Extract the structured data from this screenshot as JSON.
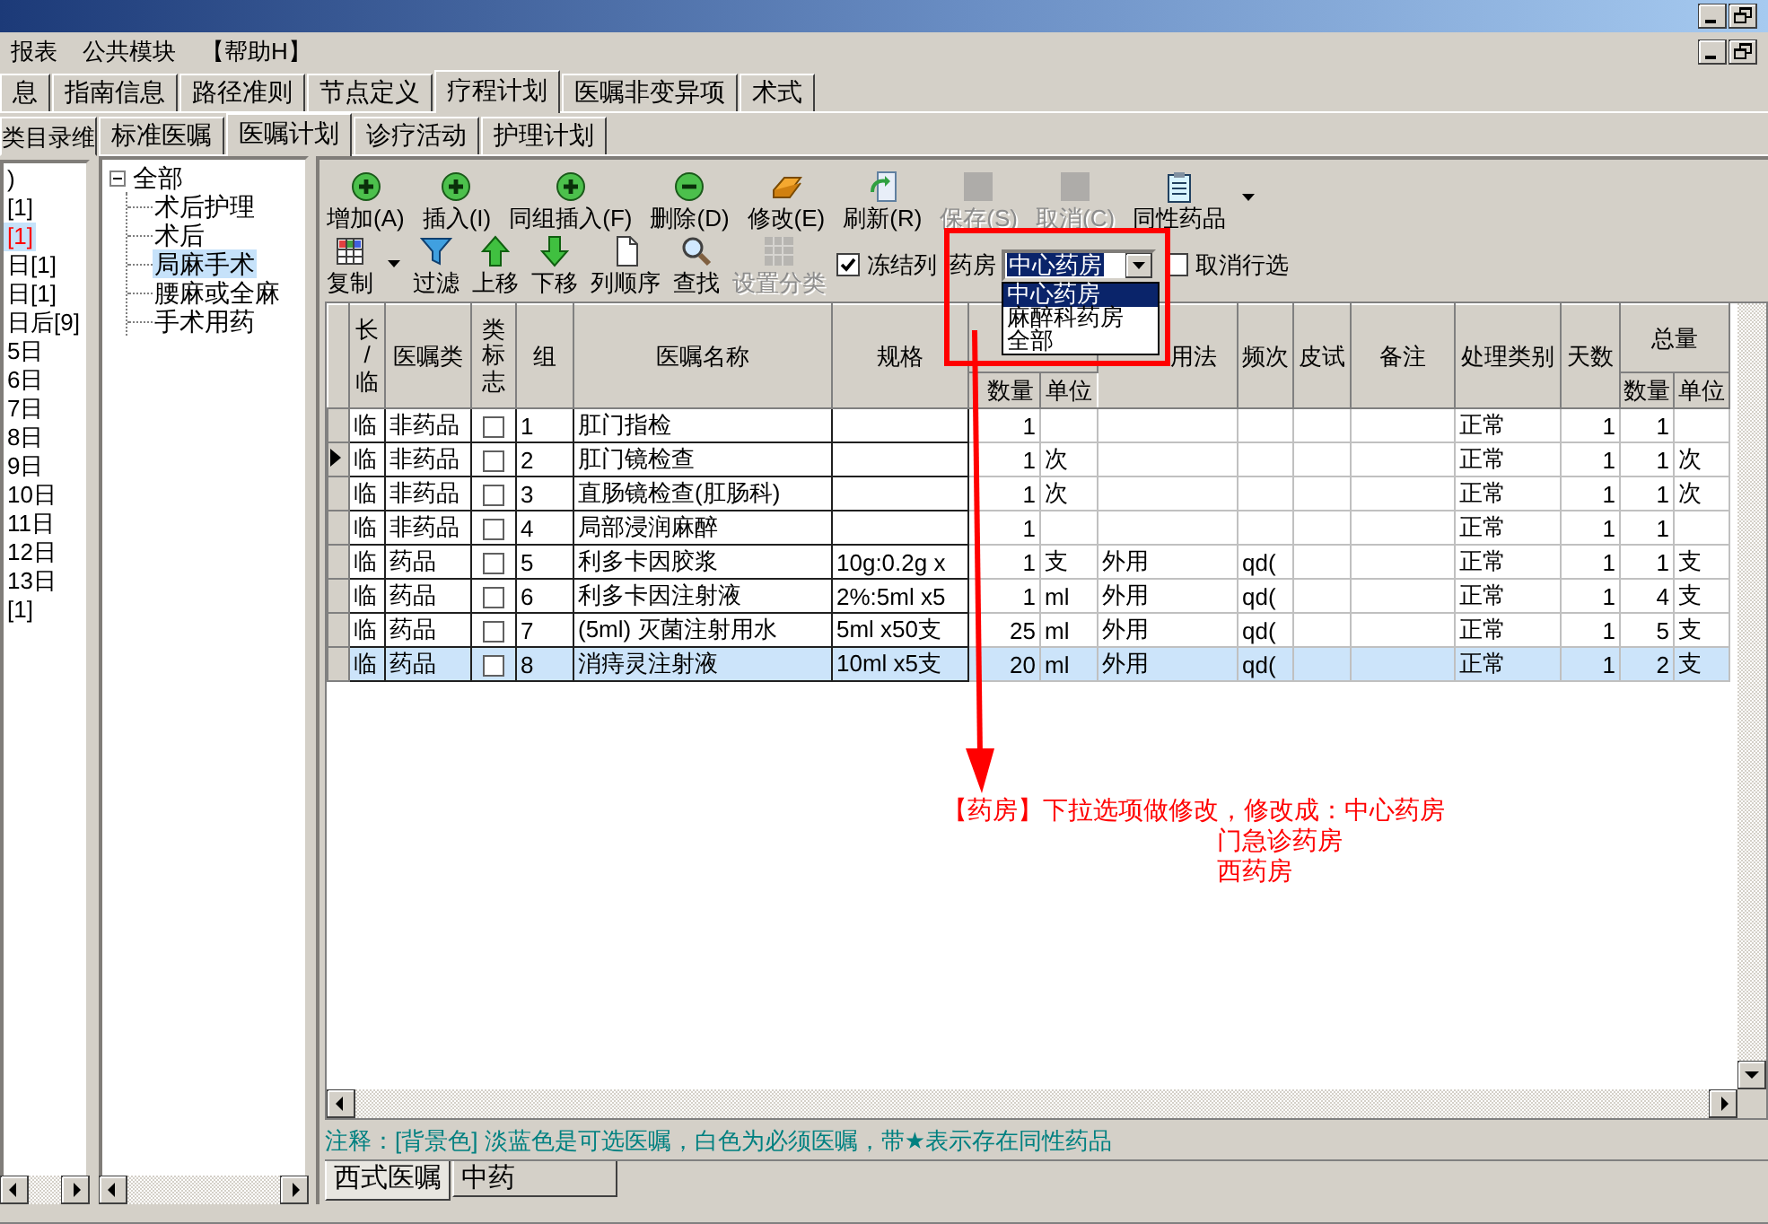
{
  "menu": [
    {
      "label": "报表"
    },
    {
      "label": "公共模块"
    },
    {
      "label": "【帮助H】"
    }
  ],
  "main_tabs": [
    {
      "label": "息",
      "selected": false
    },
    {
      "label": "指南信息",
      "selected": false
    },
    {
      "label": "路径准则",
      "selected": false
    },
    {
      "label": "节点定义",
      "selected": false
    },
    {
      "label": "疗程计划",
      "selected": true
    },
    {
      "label": "医嘱非变异项",
      "selected": false
    },
    {
      "label": "术式",
      "selected": false
    }
  ],
  "left_panel": {
    "tab": "类目录维",
    "items": [
      {
        "label": ")",
        "selected": false,
        "color": "#000000"
      },
      {
        "label": "[1]",
        "selected": false,
        "color": "#000000"
      },
      {
        "label": "[1]",
        "selected": true,
        "color": "#ff0000"
      },
      {
        "label": "日[1]",
        "selected": false,
        "color": "#000000"
      },
      {
        "label": "日[1]",
        "selected": false,
        "color": "#000000"
      },
      {
        "label": "日后[9]",
        "selected": false,
        "color": "#000000"
      },
      {
        "label": "5日",
        "selected": false,
        "color": "#000000"
      },
      {
        "label": "6日",
        "selected": false,
        "color": "#000000"
      },
      {
        "label": "7日",
        "selected": false,
        "color": "#000000"
      },
      {
        "label": "8日",
        "selected": false,
        "color": "#000000"
      },
      {
        "label": "9日",
        "selected": false,
        "color": "#000000"
      },
      {
        "label": "10日",
        "selected": false,
        "color": "#000000"
      },
      {
        "label": "11日",
        "selected": false,
        "color": "#000000"
      },
      {
        "label": "12日",
        "selected": false,
        "color": "#000000"
      },
      {
        "label": "13日",
        "selected": false,
        "color": "#000000"
      },
      {
        "label": "[1]",
        "selected": false,
        "color": "#000000"
      }
    ]
  },
  "sub_tabs": [
    {
      "label": "标准医嘱",
      "selected": false
    },
    {
      "label": "医嘱计划",
      "selected": true
    },
    {
      "label": "诊疗活动",
      "selected": false
    },
    {
      "label": "护理计划",
      "selected": false
    }
  ],
  "tree": {
    "label": "全部",
    "expanded": true,
    "children": [
      {
        "label": "术后护理",
        "selected": false
      },
      {
        "label": "术后",
        "selected": false
      },
      {
        "label": "局麻手术",
        "selected": true
      },
      {
        "label": "腰麻或全麻",
        "selected": false
      },
      {
        "label": "手术用药",
        "selected": false
      }
    ]
  },
  "toolbar": [
    {
      "kind": "add",
      "label": "增加(A)",
      "disabled": false
    },
    {
      "kind": "add",
      "label": "插入(I)",
      "disabled": false
    },
    {
      "kind": "add",
      "label": "同组插入(F)",
      "disabled": false
    },
    {
      "kind": "delete",
      "label": "删除(D)",
      "disabled": false
    },
    {
      "kind": "edit",
      "label": "修改(E)",
      "disabled": false
    },
    {
      "kind": "refresh",
      "label": "刷新(R)",
      "disabled": false
    },
    {
      "kind": "save",
      "label": "保存(S)",
      "disabled": true
    },
    {
      "kind": "cancel",
      "label": "取消(C)",
      "disabled": true
    },
    {
      "kind": "similar",
      "label": "同性药品",
      "disabled": false
    }
  ],
  "toolbar2": {
    "buttons": [
      {
        "kind": "copy",
        "label": "复制",
        "disabled": false,
        "menu": true
      },
      {
        "kind": "filter",
        "label": "过滤",
        "disabled": false,
        "menu": false
      },
      {
        "kind": "up",
        "label": "上移",
        "disabled": false,
        "menu": false
      },
      {
        "kind": "down",
        "label": "下移",
        "disabled": false,
        "menu": false
      },
      {
        "kind": "order",
        "label": "列顺序",
        "disabled": false,
        "menu": false
      },
      {
        "kind": "find",
        "label": "查找",
        "disabled": false,
        "menu": false
      },
      {
        "kind": "category",
        "label": "设置分类",
        "disabled": true,
        "menu": false
      }
    ],
    "freeze_columns": {
      "label": "冻结列",
      "checked": true
    },
    "pharmacy": {
      "label": "药房",
      "value": "中心药房",
      "expanded": true,
      "options": [
        {
          "label": "中心药房",
          "selected": true
        },
        {
          "label": "麻醉科药房",
          "selected": false
        },
        {
          "label": "全部",
          "selected": false
        }
      ]
    },
    "deselect_rows": {
      "label": "取消行选",
      "checked": false
    }
  },
  "grid": {
    "columns": [
      {
        "label": "长/临"
      },
      {
        "label": "医嘱类"
      },
      {
        "label": "类标志"
      },
      {
        "label": "组"
      },
      {
        "label": "医嘱名称"
      },
      {
        "label": "规格"
      },
      {
        "children": [
          "数量",
          "单位"
        ]
      },
      {
        "label": "用法"
      },
      {
        "label": "频次"
      },
      {
        "label": "皮试"
      },
      {
        "label": "备注"
      },
      {
        "label": "处理类别"
      },
      {
        "label": "天数"
      },
      {
        "label": "总量",
        "children": [
          "数量",
          "单位"
        ]
      }
    ],
    "rows": [
      {
        "term": "临",
        "order_class": "非药品",
        "flagged": false,
        "group": "1",
        "name": "肛门指检",
        "qty": "1",
        "handling": "正常",
        "days": "1",
        "total_qty": "1",
        "selected": false,
        "current": false
      },
      {
        "term": "临",
        "order_class": "非药品",
        "flagged": false,
        "group": "2",
        "name": "肛门镜检查",
        "qty": "1",
        "unit": "次",
        "handling": "正常",
        "days": "1",
        "total_qty": "1",
        "total_unit": "次",
        "selected": false,
        "current": true
      },
      {
        "term": "临",
        "order_class": "非药品",
        "flagged": false,
        "group": "3",
        "name": "直肠镜检查(肛肠科)",
        "qty": "1",
        "unit": "次",
        "handling": "正常",
        "days": "1",
        "total_qty": "1",
        "total_unit": "次",
        "selected": false,
        "current": false
      },
      {
        "term": "临",
        "order_class": "非药品",
        "flagged": false,
        "group": "4",
        "name": "局部浸润麻醉",
        "qty": "1",
        "handling": "正常",
        "days": "1",
        "total_qty": "1",
        "selected": false,
        "current": false
      },
      {
        "term": "临",
        "order_class": "药品",
        "flagged": false,
        "group": "5",
        "name": "利多卡因胶浆",
        "spec": "10g:0.2g x",
        "qty": "1",
        "unit": "支",
        "usage": "外用",
        "frequency": "qd(",
        "handling": "正常",
        "days": "1",
        "total_qty": "1",
        "total_unit": "支",
        "selected": false,
        "current": false
      },
      {
        "term": "临",
        "order_class": "药品",
        "flagged": false,
        "group": "6",
        "name": "利多卡因注射液",
        "spec": "2%:5ml x5",
        "qty": "1",
        "unit": "ml",
        "usage": "外用",
        "frequency": "qd(",
        "handling": "正常",
        "days": "1",
        "total_qty": "4",
        "total_unit": "支",
        "selected": false,
        "current": false
      },
      {
        "term": "临",
        "order_class": "药品",
        "flagged": false,
        "group": "7",
        "name": "(5ml) 灭菌注射用水",
        "spec": "5ml x50支",
        "qty": "25",
        "unit": "ml",
        "usage": "外用",
        "frequency": "qd(",
        "handling": "正常",
        "days": "1",
        "total_qty": "5",
        "total_unit": "支",
        "selected": false,
        "current": false
      },
      {
        "term": "临",
        "order_class": "药品",
        "flagged": false,
        "group": "8",
        "name": "消痔灵注射液",
        "spec": "10ml x5支",
        "qty": "20",
        "unit": "ml",
        "usage": "外用",
        "frequency": "qd(",
        "handling": "正常",
        "days": "1",
        "total_qty": "2",
        "total_unit": "支",
        "selected": true,
        "current": false
      }
    ]
  },
  "annotation": {
    "lines": [
      "【药房】下拉选项做修改，修改成：中心药房",
      "门急诊药房",
      "西药房"
    ]
  },
  "note": "注释：[背景色] 淡蓝色是可选医嘱，白色为必须医嘱，带★表示存在同性药品",
  "bottom_tabs": [
    {
      "label": "西式医嘱",
      "selected": true
    },
    {
      "label": "中药",
      "selected": false
    }
  ]
}
